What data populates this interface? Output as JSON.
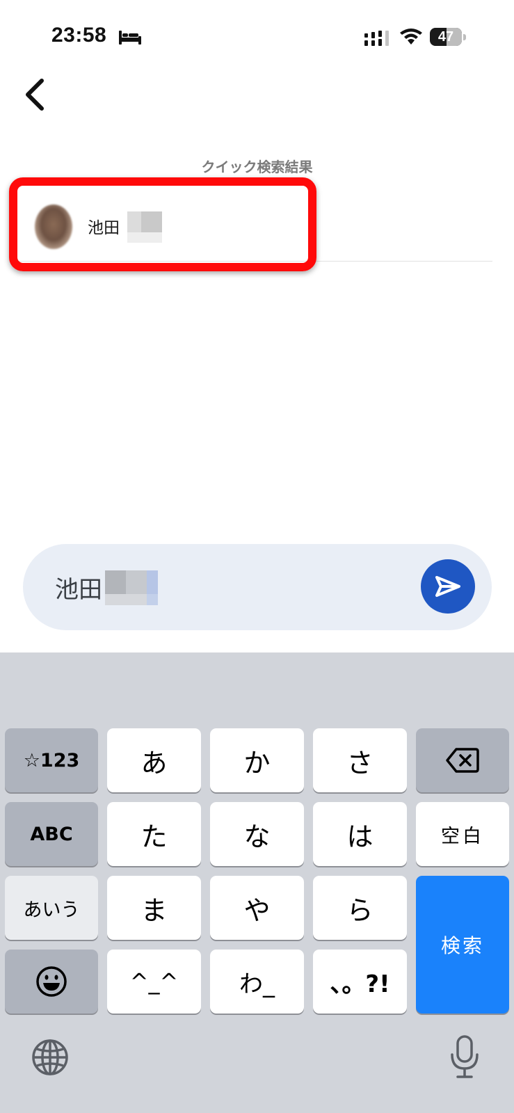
{
  "status_bar": {
    "time": "23:58",
    "battery_level": "47",
    "icons": [
      "bed-icon",
      "cellular-signal-icon",
      "wifi-icon",
      "battery-icon"
    ]
  },
  "header": {
    "back_icon": "chevron-left-icon"
  },
  "results": {
    "title": "クイック検索結果",
    "items": [
      {
        "name": "池田"
      }
    ]
  },
  "search": {
    "query": "池田"
  },
  "keyboard": {
    "row1": [
      "☆123",
      "あ",
      "か",
      "さ"
    ],
    "row2": [
      "ABC",
      "た",
      "な",
      "は",
      "空白"
    ],
    "row3": [
      "あいう",
      "ま",
      "や",
      "ら"
    ],
    "row4": [
      "^_^",
      "わ_",
      "、。?!"
    ],
    "search_key": "検索",
    "icons": [
      "backspace-icon",
      "emoji-icon",
      "globe-icon",
      "microphone-icon"
    ]
  },
  "colors": {
    "highlight": "#ff0a0a",
    "send_button": "#1f57c3",
    "search_key": "#1a82fb",
    "search_bar": "#e9eef6",
    "keyboard_bg": "#d1d4da"
  }
}
